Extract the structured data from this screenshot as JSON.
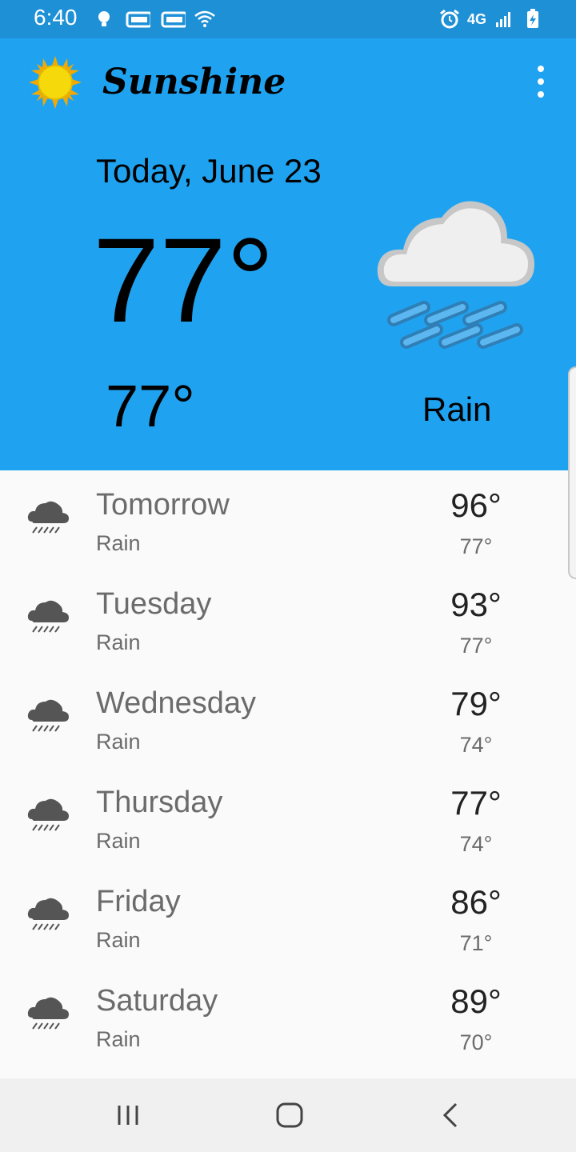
{
  "status_bar": {
    "time": "6:40",
    "left_icons": [
      "lightbulb-icon",
      "ge-app-icon",
      "ge-app-icon",
      "wifi-icon"
    ],
    "right_icons": [
      "alarm-icon",
      "4g-lte-icon",
      "signal-icon",
      "battery-charging-icon"
    ],
    "network_label": "4G"
  },
  "app": {
    "title": "Sunshine",
    "logo_icon": "sun-icon",
    "menu_icon": "more-vert-icon"
  },
  "today": {
    "date_label": "Today, June 23",
    "high": "77°",
    "low": "77°",
    "condition": "Rain",
    "icon": "rain-cloud-icon"
  },
  "forecast": [
    {
      "day": "Tomorrow",
      "condition": "Rain",
      "high": "96°",
      "low": "77°",
      "icon": "rain-cloud-icon"
    },
    {
      "day": "Tuesday",
      "condition": "Rain",
      "high": "93°",
      "low": "77°",
      "icon": "rain-cloud-icon"
    },
    {
      "day": "Wednesday",
      "condition": "Rain",
      "high": "79°",
      "low": "74°",
      "icon": "rain-cloud-icon"
    },
    {
      "day": "Thursday",
      "condition": "Rain",
      "high": "77°",
      "low": "74°",
      "icon": "rain-cloud-icon"
    },
    {
      "day": "Friday",
      "condition": "Rain",
      "high": "86°",
      "low": "71°",
      "icon": "rain-cloud-icon"
    },
    {
      "day": "Saturday",
      "condition": "Rain",
      "high": "89°",
      "low": "70°",
      "icon": "rain-cloud-icon"
    }
  ],
  "nav_bar": {
    "buttons": [
      "recent-apps-icon",
      "home-icon",
      "back-icon"
    ]
  },
  "colors": {
    "status_bar": "#1e90d6",
    "header": "#1fa3f1",
    "list_background": "#fafafa",
    "secondary_text": "#6b6b6b",
    "primary_text": "#222222"
  }
}
